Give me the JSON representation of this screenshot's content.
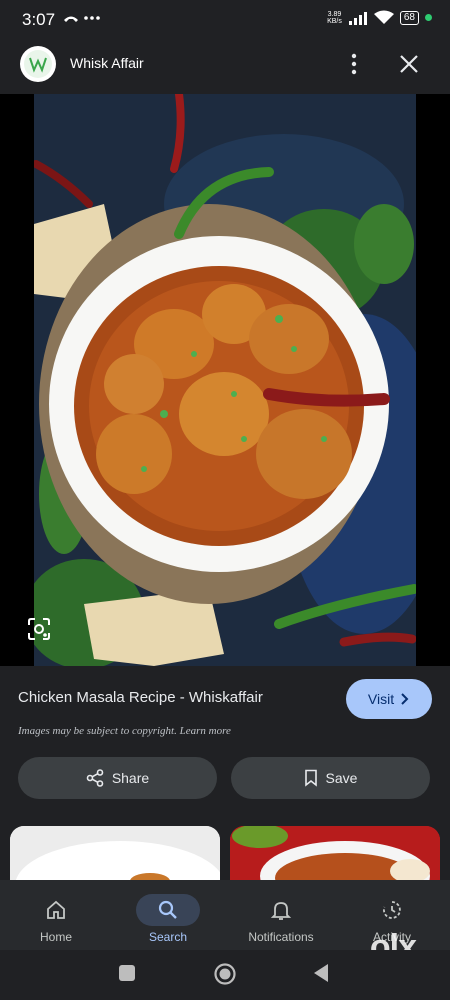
{
  "status": {
    "time": "3:07",
    "netspeed_value": "3.89",
    "netspeed_unit": "KB/s",
    "battery": "68"
  },
  "header": {
    "site_name": "Whisk Affair",
    "logo_letter": "W"
  },
  "result": {
    "title": "Chicken Masala Recipe - Whiskaffair",
    "visit_label": "Visit",
    "copyright": "Images may be subject to copyright. Learn more"
  },
  "actions": {
    "share_label": "Share",
    "save_label": "Save"
  },
  "nav": {
    "items": [
      {
        "label": "Home",
        "icon": "home-icon"
      },
      {
        "label": "Search",
        "icon": "search-icon"
      },
      {
        "label": "Notifications",
        "icon": "bell-icon"
      },
      {
        "label": "Activity",
        "icon": "activity-icon"
      }
    ]
  },
  "watermark": {
    "text": "olx"
  },
  "colors": {
    "accent": "#a8c7fa",
    "background": "#202124",
    "pill": "#3c4043"
  }
}
